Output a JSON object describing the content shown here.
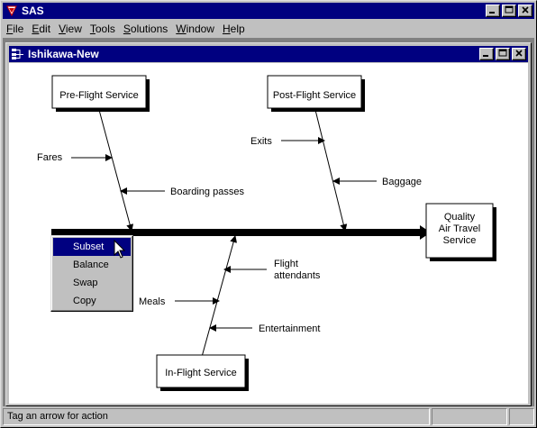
{
  "app": {
    "title": "SAS"
  },
  "menubar": {
    "items": [
      {
        "label": "File",
        "key": "F",
        "rest": "ile"
      },
      {
        "label": "Edit",
        "key": "E",
        "rest": "dit"
      },
      {
        "label": "View",
        "key": "V",
        "rest": "iew"
      },
      {
        "label": "Tools",
        "key": "T",
        "rest": "ools"
      },
      {
        "label": "Solutions",
        "key": "S",
        "rest": "olutions"
      },
      {
        "label": "Window",
        "key": "W",
        "rest": "indow"
      },
      {
        "label": "Help",
        "key": "H",
        "rest": "elp"
      }
    ]
  },
  "child_window": {
    "title": "Ishikawa-New"
  },
  "diagram": {
    "effect": [
      "Quality",
      "Air Travel",
      "Service"
    ],
    "categories": {
      "pre_flight": "Pre-Flight Service",
      "post_flight": "Post-Flight Service",
      "in_flight": "In-Flight Service"
    },
    "causes": {
      "fares": "Fares",
      "boarding_passes": "Boarding passes",
      "exits": "Exits",
      "baggage": "Baggage",
      "flight_attendants_1": "Flight",
      "flight_attendants_2": "attendants",
      "meals": "Meals",
      "entertainment": "Entertainment"
    }
  },
  "context_menu": {
    "items": [
      "Subset",
      "Balance",
      "Swap",
      "Copy"
    ],
    "selected": "Subset"
  },
  "status": {
    "message": "Tag an arrow for action"
  },
  "colors": {
    "title_bar": "#000080",
    "face": "#c0c0c0",
    "selection": "#000080"
  }
}
